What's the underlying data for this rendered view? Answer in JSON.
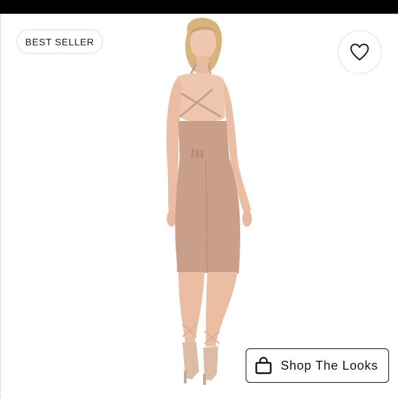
{
  "badge": {
    "label": "BEST SELLER"
  },
  "favorite": {
    "icon": "heart-icon"
  },
  "shop_button": {
    "label": "Shop The Looks",
    "icon": "shopping-bag-icon"
  },
  "product_image": {
    "alt": "Model wearing a nude lace-up back midi dress"
  },
  "colors": {
    "dress": "#c99f8a",
    "skin": "#efc6ae",
    "hair": "#d9b47a",
    "top_bar": "#000000"
  }
}
